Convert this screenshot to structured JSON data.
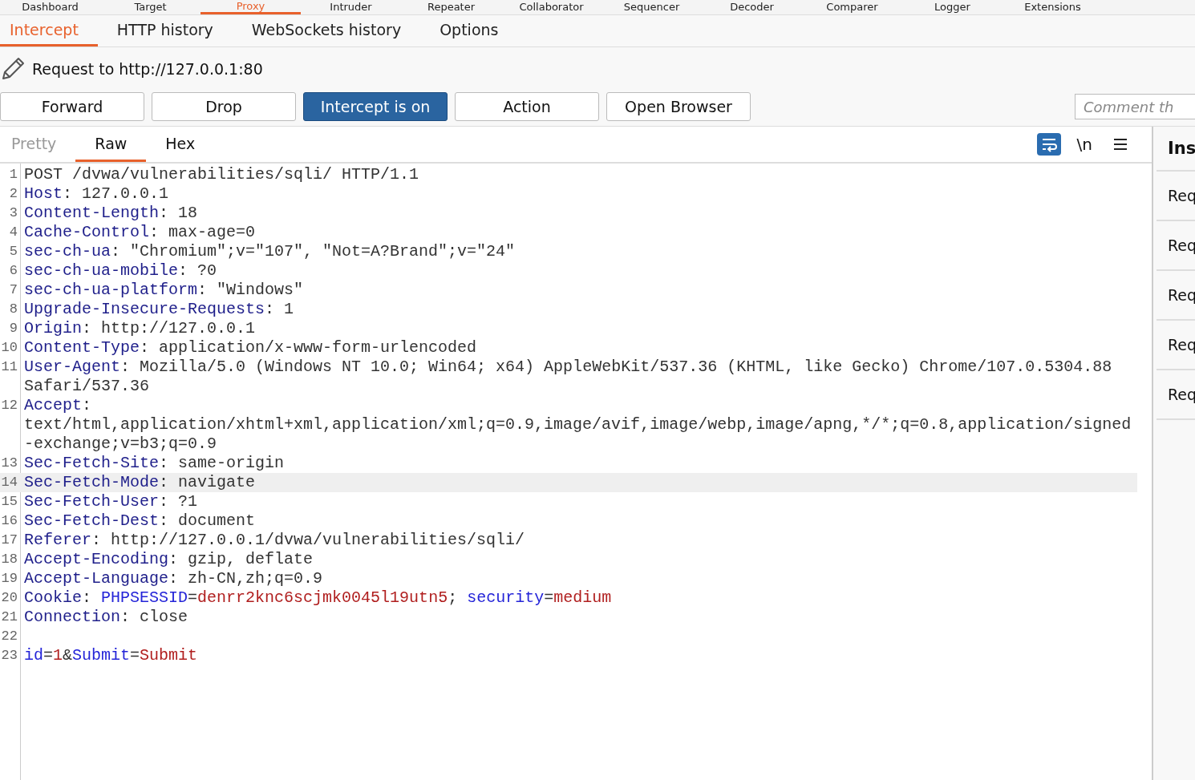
{
  "top_tabs": [
    {
      "label": "Dashboard",
      "selected": false
    },
    {
      "label": "Target",
      "selected": false
    },
    {
      "label": "Proxy",
      "selected": true
    },
    {
      "label": "Intruder",
      "selected": false
    },
    {
      "label": "Repeater",
      "selected": false
    },
    {
      "label": "Collaborator",
      "selected": false
    },
    {
      "label": "Sequencer",
      "selected": false
    },
    {
      "label": "Decoder",
      "selected": false
    },
    {
      "label": "Comparer",
      "selected": false
    },
    {
      "label": "Logger",
      "selected": false
    },
    {
      "label": "Extensions",
      "selected": false
    }
  ],
  "proxy_tabs": [
    {
      "label": "Intercept",
      "selected": true
    },
    {
      "label": "HTTP history",
      "selected": false
    },
    {
      "label": "WebSockets history",
      "selected": false
    },
    {
      "label": "Options",
      "selected": false
    }
  ],
  "request_title": "Request to http://127.0.0.1:80",
  "buttons": [
    {
      "label": "Forward",
      "on": false
    },
    {
      "label": "Drop",
      "on": false
    },
    {
      "label": "Intercept is on",
      "on": true
    },
    {
      "label": "Action",
      "on": false
    },
    {
      "label": "Open Browser",
      "on": false
    }
  ],
  "comment_field": {
    "placeholder": "Comment th"
  },
  "editor_tabs": [
    {
      "label": "Pretty",
      "selected": false,
      "disabled": true
    },
    {
      "label": "Raw",
      "selected": true,
      "disabled": false
    },
    {
      "label": "Hex",
      "selected": false,
      "disabled": false
    }
  ],
  "editor_toolbar": {
    "wrap_on": true,
    "newline_label": "\\n"
  },
  "lines": [
    {
      "number": "1",
      "highlighted": false,
      "rows": [
        [
          {
            "kind": "text",
            "text": "POST /dvwa/vulnerabilities/sqli/ HTTP/1.1"
          }
        ]
      ]
    },
    {
      "number": "2",
      "highlighted": false,
      "rows": [
        [
          {
            "kind": "name",
            "text": "Host"
          },
          {
            "kind": "text",
            "text": ": 127.0.0.1"
          }
        ]
      ]
    },
    {
      "number": "3",
      "highlighted": false,
      "rows": [
        [
          {
            "kind": "name",
            "text": "Content-Length"
          },
          {
            "kind": "text",
            "text": ": 18"
          }
        ]
      ]
    },
    {
      "number": "4",
      "highlighted": false,
      "rows": [
        [
          {
            "kind": "name",
            "text": "Cache-Control"
          },
          {
            "kind": "text",
            "text": ": max-age=0"
          }
        ]
      ]
    },
    {
      "number": "5",
      "highlighted": false,
      "rows": [
        [
          {
            "kind": "name",
            "text": "sec-ch-ua"
          },
          {
            "kind": "text",
            "text": ": \"Chromium\";v=\"107\", \"Not=A?Brand\";v=\"24\""
          }
        ]
      ]
    },
    {
      "number": "6",
      "highlighted": false,
      "rows": [
        [
          {
            "kind": "name",
            "text": "sec-ch-ua-mobile"
          },
          {
            "kind": "text",
            "text": ": ?0"
          }
        ]
      ]
    },
    {
      "number": "7",
      "highlighted": false,
      "rows": [
        [
          {
            "kind": "name",
            "text": "sec-ch-ua-platform"
          },
          {
            "kind": "text",
            "text": ": \"Windows\""
          }
        ]
      ]
    },
    {
      "number": "8",
      "highlighted": false,
      "rows": [
        [
          {
            "kind": "name",
            "text": "Upgrade-Insecure-Requests"
          },
          {
            "kind": "text",
            "text": ": 1"
          }
        ]
      ]
    },
    {
      "number": "9",
      "highlighted": false,
      "rows": [
        [
          {
            "kind": "name",
            "text": "Origin"
          },
          {
            "kind": "text",
            "text": ": http://127.0.0.1"
          }
        ]
      ]
    },
    {
      "number": "10",
      "highlighted": false,
      "rows": [
        [
          {
            "kind": "name",
            "text": "Content-Type"
          },
          {
            "kind": "text",
            "text": ": application/x-www-form-urlencoded"
          }
        ]
      ]
    },
    {
      "number": "11",
      "highlighted": false,
      "rows": [
        [
          {
            "kind": "name",
            "text": "User-Agent"
          },
          {
            "kind": "text",
            "text": ": Mozilla/5.0 (Windows NT 10.0; Win64; x64) AppleWebKit/537.36 (KHTML, like Gecko) Chrome/107.0.5304.88"
          }
        ],
        [
          {
            "kind": "text",
            "text": "Safari/537.36"
          }
        ]
      ]
    },
    {
      "number": "12",
      "highlighted": false,
      "rows": [
        [
          {
            "kind": "name",
            "text": "Accept"
          },
          {
            "kind": "text",
            "text": ":"
          }
        ],
        [
          {
            "kind": "text",
            "text": "text/html,application/xhtml+xml,application/xml;q=0.9,image/avif,image/webp,image/apng,*/*;q=0.8,application/signed"
          }
        ],
        [
          {
            "kind": "text",
            "text": "-exchange;v=b3;q=0.9"
          }
        ]
      ]
    },
    {
      "number": "13",
      "highlighted": false,
      "rows": [
        [
          {
            "kind": "name",
            "text": "Sec-Fetch-Site"
          },
          {
            "kind": "text",
            "text": ": same-origin"
          }
        ]
      ]
    },
    {
      "number": "14",
      "highlighted": true,
      "rows": [
        [
          {
            "kind": "name",
            "text": "Sec-Fetch-Mode"
          },
          {
            "kind": "text",
            "text": ": navigate"
          }
        ]
      ]
    },
    {
      "number": "15",
      "highlighted": false,
      "rows": [
        [
          {
            "kind": "name",
            "text": "Sec-Fetch-User"
          },
          {
            "kind": "text",
            "text": ": ?1"
          }
        ]
      ]
    },
    {
      "number": "16",
      "highlighted": false,
      "rows": [
        [
          {
            "kind": "name",
            "text": "Sec-Fetch-Dest"
          },
          {
            "kind": "text",
            "text": ": document"
          }
        ]
      ]
    },
    {
      "number": "17",
      "highlighted": false,
      "rows": [
        [
          {
            "kind": "name",
            "text": "Referer"
          },
          {
            "kind": "text",
            "text": ": http://127.0.0.1/dvwa/vulnerabilities/sqli/"
          }
        ]
      ]
    },
    {
      "number": "18",
      "highlighted": false,
      "rows": [
        [
          {
            "kind": "name",
            "text": "Accept-Encoding"
          },
          {
            "kind": "text",
            "text": ": gzip, deflate"
          }
        ]
      ]
    },
    {
      "number": "19",
      "highlighted": false,
      "rows": [
        [
          {
            "kind": "name",
            "text": "Accept-Language"
          },
          {
            "kind": "text",
            "text": ": zh-CN,zh;q=0.9"
          }
        ]
      ]
    },
    {
      "number": "20",
      "highlighted": false,
      "rows": [
        [
          {
            "kind": "name",
            "text": "Cookie"
          },
          {
            "kind": "text",
            "text": ": "
          },
          {
            "kind": "pname",
            "text": "PHPSESSID"
          },
          {
            "kind": "text",
            "text": "="
          },
          {
            "kind": "pval",
            "text": "denrr2knc6scjmk0045l19utn5"
          },
          {
            "kind": "text",
            "text": "; "
          },
          {
            "kind": "pname",
            "text": "security"
          },
          {
            "kind": "text",
            "text": "="
          },
          {
            "kind": "pval",
            "text": "medium"
          }
        ]
      ]
    },
    {
      "number": "21",
      "highlighted": false,
      "rows": [
        [
          {
            "kind": "name",
            "text": "Connection"
          },
          {
            "kind": "text",
            "text": ": close"
          }
        ]
      ]
    },
    {
      "number": "22",
      "highlighted": false,
      "rows": [
        []
      ]
    },
    {
      "number": "23",
      "highlighted": false,
      "rows": [
        [
          {
            "kind": "pname",
            "text": "id"
          },
          {
            "kind": "text",
            "text": "="
          },
          {
            "kind": "pval",
            "text": "1"
          },
          {
            "kind": "text",
            "text": "&"
          },
          {
            "kind": "pname",
            "text": "Submit"
          },
          {
            "kind": "text",
            "text": "="
          },
          {
            "kind": "pval",
            "text": "Submit"
          }
        ]
      ]
    }
  ],
  "inspector": {
    "title": "Ins",
    "items": [
      "Req",
      "Req",
      "Req",
      "Req",
      "Req"
    ]
  }
}
